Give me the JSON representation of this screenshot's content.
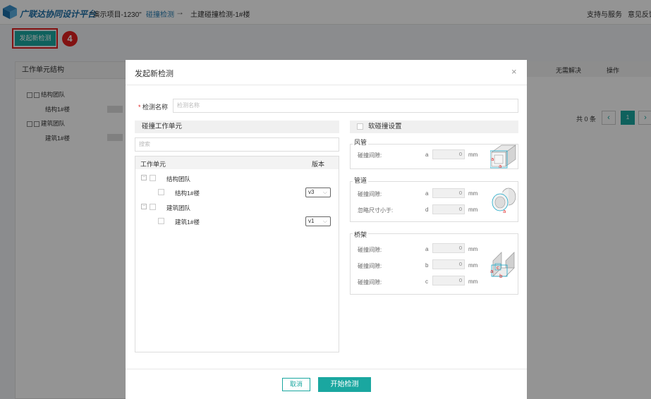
{
  "header": {
    "brand": "广联达协同设计平台",
    "project": "\"演示项目-1230\"",
    "breadcrumb_1": "碰撞检测",
    "breadcrumb_2": "土建碰撞检测-1#楼",
    "nav_support": "支持与服务",
    "nav_feedback": "意见反馈"
  },
  "page": {
    "new_check_button": "发起新检测",
    "step_badge": "4",
    "left_panel_title": "工作单元结构",
    "tree": [
      {
        "label": "结构团队"
      },
      {
        "label": "结构1#楼"
      },
      {
        "label": "建筑团队"
      },
      {
        "label": "建筑1#楼"
      }
    ],
    "col_unresolved": "无需解决",
    "col_action": "操作",
    "total": "共 0 条",
    "page_prev": "‹",
    "page_current": "1",
    "page_next": "›"
  },
  "modal": {
    "title": "发起新检测",
    "close": "×",
    "name_label": "检测名称",
    "name_placeholder": "检测名称",
    "left_section_title": "碰撞工作单元",
    "search_placeholder": "搜索",
    "col_unit": "工作单元",
    "col_version": "版本",
    "units": [
      {
        "label": "结构团队"
      },
      {
        "label": "结构1#楼",
        "version": "v3"
      },
      {
        "label": "建筑团队"
      },
      {
        "label": "建筑1#楼",
        "version": "v1"
      }
    ],
    "soft_collision": "软碰撞设置",
    "groups": [
      {
        "title": "风管",
        "rows": [
          {
            "label": "碰撞间隙:",
            "var": "a",
            "value": "0",
            "unit": "mm"
          }
        ]
      },
      {
        "title": "管道",
        "rows": [
          {
            "label": "碰撞间隙:",
            "var": "a",
            "value": "0",
            "unit": "mm"
          },
          {
            "label": "忽略尺寸小于:",
            "var": "d",
            "value": "0",
            "unit": "mm"
          }
        ]
      },
      {
        "title": "桥架",
        "rows": [
          {
            "label": "碰撞间隙:",
            "var": "a",
            "value": "0",
            "unit": "mm"
          },
          {
            "label": "碰撞间隙:",
            "var": "b",
            "value": "0",
            "unit": "mm"
          },
          {
            "label": "碰撞间隙:",
            "var": "c",
            "value": "0",
            "unit": "mm"
          }
        ]
      }
    ],
    "cancel_button": "取消",
    "start_button": "开始检测"
  }
}
